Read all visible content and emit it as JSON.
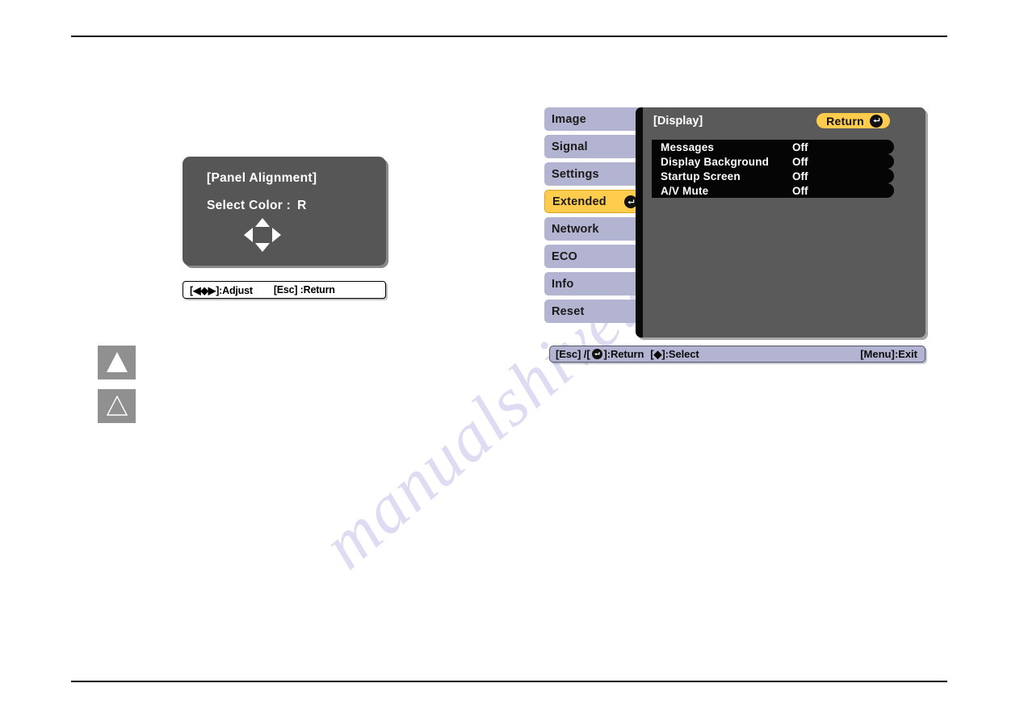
{
  "page": {
    "watermark": "manualshive.com"
  },
  "osd_dialog": {
    "title": "[Panel Alignment]",
    "select_color_label": "Select Color :",
    "select_color_value": "R",
    "dpad_icon": "dpad-icon"
  },
  "osd_footer": {
    "adjust": "[◀◆▶]:Adjust",
    "return": "[Esc] :Return"
  },
  "margin_notes": [
    {
      "name": "warning-triangle-filled",
      "style": "filled"
    },
    {
      "name": "caution-triangle-outline",
      "style": "outline"
    }
  ],
  "projector_menu": {
    "sidebar": [
      {
        "label": "Image",
        "active": false
      },
      {
        "label": "Signal",
        "active": false
      },
      {
        "label": "Settings",
        "active": false
      },
      {
        "label": "Extended",
        "active": true
      },
      {
        "label": "Network",
        "active": false
      },
      {
        "label": "ECO",
        "active": false
      },
      {
        "label": "Info",
        "active": false
      },
      {
        "label": "Reset",
        "active": false
      }
    ],
    "body": {
      "title": "[Display]",
      "return_button": "Return",
      "rows": [
        {
          "label": "Messages",
          "value": "Off"
        },
        {
          "label": "Display Background",
          "value": "Off"
        },
        {
          "label": "Startup Screen",
          "value": "Off"
        },
        {
          "label": "A/V Mute",
          "value": "Off"
        }
      ]
    },
    "statusbar": {
      "return_prefix": "[Esc] /[",
      "return_suffix": "]:Return",
      "select": "[◆]:Select",
      "exit": "[Menu]:Exit"
    }
  },
  "colors": {
    "tab_normal": "#b3b3d2",
    "tab_active": "#ffcc4d",
    "panel_gray": "#5a5a5a",
    "row_black": "#050505",
    "dialog_gray": "#565656",
    "watermark": "#c9c7ec"
  }
}
